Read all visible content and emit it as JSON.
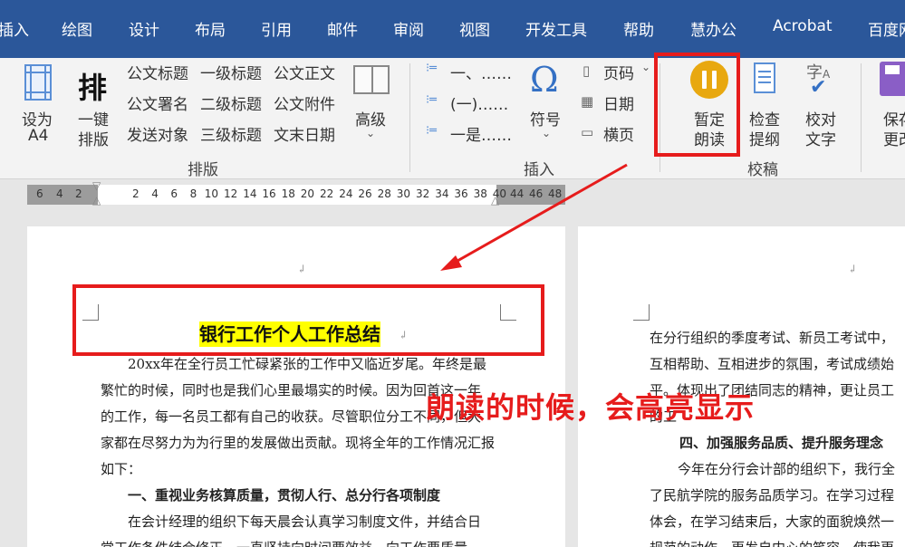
{
  "menu": {
    "tabs": [
      "插入",
      "绘图",
      "设计",
      "布局",
      "引用",
      "邮件",
      "审阅",
      "视图",
      "开发工具",
      "帮助",
      "慧办公",
      "Acrobat",
      "百度网"
    ]
  },
  "ribbon": {
    "a4": [
      "设为",
      "A4"
    ],
    "onekey": [
      "排",
      "一键",
      "排版"
    ],
    "styles": [
      "公文标题",
      "一级标题",
      "公文正文",
      "公文署名",
      "二级标题",
      "公文附件",
      "发送对象",
      "三级标题",
      "文末日期"
    ],
    "advanced": "高级",
    "group_paiban": "排版",
    "list": [
      "一、……",
      "(一)……",
      "一是……"
    ],
    "symbol": "符号",
    "page_items": [
      "页码",
      "日期",
      "横页"
    ],
    "group_insert": "插入",
    "pause_read": [
      "暂定",
      "朗读"
    ],
    "check": [
      "检查",
      "提纲"
    ],
    "proof": [
      "校对",
      "文字"
    ],
    "group_jiaogao": "校稿",
    "save": [
      "保存",
      "更改"
    ]
  },
  "ruler": {
    "left_ticks": [
      "6",
      "4",
      "2"
    ],
    "ticks": [
      "2",
      "4",
      "6",
      "8",
      "10",
      "12",
      "14",
      "16",
      "18",
      "20",
      "22",
      "24",
      "26",
      "28",
      "30",
      "32",
      "34",
      "36",
      "38",
      "40"
    ],
    "right_ticks": [
      "44",
      "46",
      "48"
    ]
  },
  "doc": {
    "title": "银行工作个人工作总结",
    "left_lines": [
      "20xx年在全行员工忙碌紧张的工作中又临近岁尾。年终是最",
      "繁忙的时候，同时也是我们心里最塌实的时候。因为回首这一年",
      "的工作，每一名员工都有自己的收获。尽管职位分工不同，但大",
      "家都在尽努力为为行里的发展做出贡献。现将全年的工作情况汇报",
      "如下："
    ],
    "left_heading": "一、重视业务核算质量，贯彻人行、总分行各项制度",
    "left_more": [
      "在会计经理的组织下每天晨会认真学习制度文件，并结合日",
      "常工作条件结合修正，一直坚持向时间要效益，向工作要质量"
    ],
    "right_lines": [
      "在分行组织的季度考试、新员工考试中，",
      "互相帮助、互相进步的氛围，考试成绩始",
      "平。体现出了团结同志的精神，更让员工",
      "的工"
    ],
    "right_heading": "四、加强服务品质、提升服务理念",
    "right_more": [
      "今年在分行会计部的组织下，我行全",
      "了民航学院的服务品质学习。在学习过程",
      "体会，在学习结束后，大家的面貌焕然一",
      "规范的动作，更发自内心的笑容，使我更"
    ]
  },
  "annotation": "朗读的时候，会高亮显示",
  "colors": {
    "menubar": "#2b579a",
    "ribbon": "#f3f3f3",
    "highlight": "#ffff00",
    "annotation": "#e61c1c"
  }
}
